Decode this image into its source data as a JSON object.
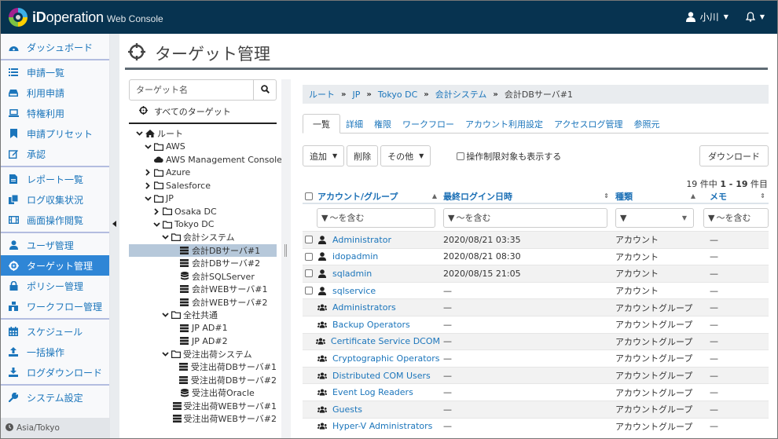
{
  "app": {
    "brand_prefix": "iD",
    "brand_name": "operation",
    "brand_sub": "Web Console",
    "user_name": "小川",
    "colors": {
      "header": "#073350",
      "accent": "#2f86d6",
      "link": "#1b75bb"
    }
  },
  "sidebar": {
    "groups": [
      [
        {
          "label": "ダッシュボード",
          "icon": "dashboard-icon"
        }
      ],
      [
        {
          "label": "申請一覧",
          "icon": "list-icon"
        },
        {
          "label": "利用申請",
          "icon": "hdd-icon"
        },
        {
          "label": "特権利用",
          "icon": "laptop-icon"
        },
        {
          "label": "申請プリセット",
          "icon": "bookmark-icon"
        },
        {
          "label": "承認",
          "icon": "edit-icon"
        }
      ],
      [
        {
          "label": "レポート一覧",
          "icon": "file-icon"
        },
        {
          "label": "ログ収集状況",
          "icon": "copy-icon"
        },
        {
          "label": "画面操作閲覧",
          "icon": "film-icon"
        }
      ],
      [
        {
          "label": "ユーザ管理",
          "icon": "user-icon"
        },
        {
          "label": "ターゲット管理",
          "icon": "crosshairs-icon",
          "active": true
        },
        {
          "label": "ポリシー管理",
          "icon": "lock-icon"
        },
        {
          "label": "ワークフロー管理",
          "icon": "sitemap-icon"
        }
      ],
      [
        {
          "label": "スケジュール",
          "icon": "calendar-icon"
        },
        {
          "label": "一括操作",
          "icon": "upload-icon"
        },
        {
          "label": "ログダウンロード",
          "icon": "download-icon"
        }
      ],
      [
        {
          "label": "システム設定",
          "icon": "wrench-icon"
        }
      ]
    ],
    "timezone": "Asia/Tokyo"
  },
  "page": {
    "title": "ターゲット管理"
  },
  "tree": {
    "search_placeholder": "ターゲット名",
    "all_targets": "すべてのターゲット",
    "nodes": [
      {
        "label": "ルート",
        "depth": 0,
        "toggle": "open",
        "icon": "home"
      },
      {
        "label": "AWS",
        "depth": 1,
        "toggle": "open",
        "icon": "folder"
      },
      {
        "label": "AWS Management Console",
        "depth": 2,
        "toggle": "none",
        "icon": "cloud"
      },
      {
        "label": "Azure",
        "depth": 1,
        "toggle": "closed",
        "icon": "folder"
      },
      {
        "label": "Salesforce",
        "depth": 1,
        "toggle": "closed",
        "icon": "folder"
      },
      {
        "label": "JP",
        "depth": 1,
        "toggle": "open",
        "icon": "folder"
      },
      {
        "label": "Osaka DC",
        "depth": 2,
        "toggle": "closed",
        "icon": "folder"
      },
      {
        "label": "Tokyo DC",
        "depth": 2,
        "toggle": "open",
        "icon": "folder"
      },
      {
        "label": "会計システム",
        "depth": 3,
        "toggle": "open",
        "icon": "folder"
      },
      {
        "label": "会計DBサーバ#1",
        "depth": 4,
        "toggle": "none",
        "icon": "server",
        "selected": true
      },
      {
        "label": "会計DBサーバ#2",
        "depth": 4,
        "toggle": "none",
        "icon": "server"
      },
      {
        "label": "会計SQLServer",
        "depth": 4,
        "toggle": "none",
        "icon": "database"
      },
      {
        "label": "会計WEBサーバ#1",
        "depth": 4,
        "toggle": "none",
        "icon": "server"
      },
      {
        "label": "会計WEBサーバ#2",
        "depth": 4,
        "toggle": "none",
        "icon": "server"
      },
      {
        "label": "全社共通",
        "depth": 3,
        "toggle": "open",
        "icon": "folder"
      },
      {
        "label": "JP AD#1",
        "depth": 4,
        "toggle": "none",
        "icon": "server"
      },
      {
        "label": "JP AD#2",
        "depth": 4,
        "toggle": "none",
        "icon": "server"
      },
      {
        "label": "受注出荷システム",
        "depth": 3,
        "toggle": "open",
        "icon": "folder"
      },
      {
        "label": "受注出荷DBサーバ#1",
        "depth": 4,
        "toggle": "none",
        "icon": "server"
      },
      {
        "label": "受注出荷DBサーバ#2",
        "depth": 4,
        "toggle": "none",
        "icon": "server"
      },
      {
        "label": "受注出荷Oracle",
        "depth": 4,
        "toggle": "none",
        "icon": "database"
      },
      {
        "label": "受注出荷WEBサーバ#1",
        "depth": 4,
        "toggle": "none",
        "icon": "server"
      },
      {
        "label": "受注出荷WEBサーバ#2",
        "depth": 4,
        "toggle": "none",
        "icon": "server"
      }
    ]
  },
  "breadcrumb": {
    "links": [
      "ルート",
      "JP",
      "Tokyo DC",
      "会計システム"
    ],
    "current": "会計DBサーバ#1"
  },
  "tabs": [
    {
      "label": "一覧",
      "active": true
    },
    {
      "label": "詳細"
    },
    {
      "label": "権限"
    },
    {
      "label": "ワークフロー"
    },
    {
      "label": "アカウント利用設定"
    },
    {
      "label": "アクセスログ管理"
    },
    {
      "label": "参照元"
    }
  ],
  "toolbar": {
    "add_label": "追加",
    "delete_label": "削除",
    "other_label": "その他",
    "show_restricted_label": "操作制限対象も表示する",
    "download_label": "ダウンロード"
  },
  "count": {
    "total": "19",
    "mid": "件中",
    "range": "1 - 19",
    "suffix": "件目"
  },
  "table": {
    "columns": [
      {
        "label": "アカウント/グループ",
        "sort": "asc"
      },
      {
        "label": "最終ログイン日時",
        "sort": "none"
      },
      {
        "label": "種類",
        "sort": "asc"
      },
      {
        "label": "メモ",
        "sort": "none"
      }
    ],
    "filters": {
      "account_placeholder": "～を含む",
      "login_placeholder": "～を含む",
      "type_value": "",
      "memo_placeholder": "～を含む"
    },
    "rows": [
      {
        "kind": "user",
        "name": "Administrator",
        "last_login": "2020/08/21 03:35",
        "type": "アカウント",
        "memo": "—"
      },
      {
        "kind": "user",
        "name": "idopadmin",
        "last_login": "2020/08/21 08:30",
        "type": "アカウント",
        "memo": "—"
      },
      {
        "kind": "user",
        "name": "sqladmin",
        "last_login": "2020/08/15 21:05",
        "type": "アカウント",
        "memo": "—"
      },
      {
        "kind": "user",
        "name": "sqlservice",
        "last_login": "—",
        "type": "アカウント",
        "memo": "—"
      },
      {
        "kind": "group",
        "name": "Administrators",
        "last_login": "—",
        "type": "アカウントグループ",
        "memo": "—"
      },
      {
        "kind": "group",
        "name": "Backup Operators",
        "last_login": "—",
        "type": "アカウントグループ",
        "memo": "—"
      },
      {
        "kind": "group",
        "name": "Certificate Service DCOM",
        "last_login": "—",
        "type": "アカウントグループ",
        "memo": "—"
      },
      {
        "kind": "group",
        "name": "Cryptographic Operators",
        "last_login": "—",
        "type": "アカウントグループ",
        "memo": "—"
      },
      {
        "kind": "group",
        "name": "Distributed COM Users",
        "last_login": "—",
        "type": "アカウントグループ",
        "memo": "—"
      },
      {
        "kind": "group",
        "name": "Event Log Readers",
        "last_login": "—",
        "type": "アカウントグループ",
        "memo": "—"
      },
      {
        "kind": "group",
        "name": "Guests",
        "last_login": "—",
        "type": "アカウントグループ",
        "memo": "—"
      },
      {
        "kind": "group",
        "name": "Hyper-V Administrators",
        "last_login": "—",
        "type": "アカウントグループ",
        "memo": "—"
      }
    ]
  }
}
